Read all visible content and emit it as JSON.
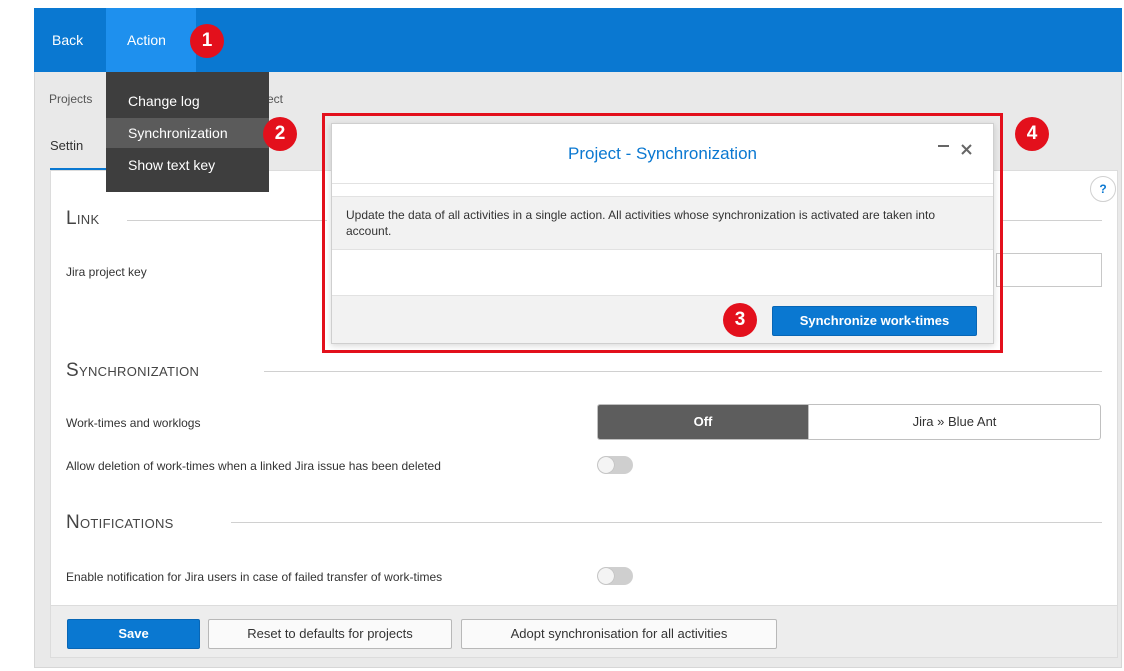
{
  "topbar": {
    "back_label": "Back",
    "action_label": "Action",
    "color": "#0a78d1"
  },
  "action_menu": {
    "items": [
      {
        "label": "Change log"
      },
      {
        "label": "Synchronization"
      },
      {
        "label": "Show text key"
      }
    ]
  },
  "breadcrumb": {
    "first": "Projects",
    "tail": "ect"
  },
  "tabs": {
    "settings_label": "Settin"
  },
  "help_label": "?",
  "sections": {
    "link": {
      "title": "Link",
      "jira_project_key_label": "Jira project key"
    },
    "synchronization": {
      "title": "Synchronization",
      "worktimes_label": "Work-times and worklogs",
      "options": [
        "Off",
        "Jira » Blue Ant"
      ],
      "selected": "Off",
      "allow_deletion_label": "Allow deletion of work-times when a linked Jira issue has been deleted"
    },
    "notifications": {
      "title": "Notifications",
      "enable_notification_label": "Enable notification for Jira users in case of failed transfer of work-times"
    }
  },
  "footer": {
    "save_label": "Save",
    "reset_label": "Reset to defaults for projects",
    "adopt_label": "Adopt synchronisation for all activities"
  },
  "dialog": {
    "title": "Project - Synchronization",
    "description": "Update the data of all activities in a single action. All activities whose synchronization is activated are taken into account.",
    "sync_button_label": "Synchronize work-times"
  },
  "badges": [
    "1",
    "2",
    "3",
    "4"
  ],
  "colors": {
    "accent": "#0a78d1",
    "highlight": "#e3101c",
    "menu_bg": "#3e3e3e"
  }
}
